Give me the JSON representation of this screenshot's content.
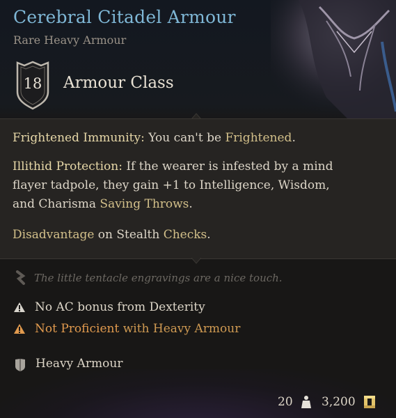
{
  "item": {
    "name": "Cerebral Citadel Armour",
    "rarity_type": "Rare Heavy Armour",
    "armour_class_value": "18",
    "armour_class_label": "Armour Class"
  },
  "properties": {
    "p1_name": "Frightened Immunity:",
    "p1_text_a": " You can't be ",
    "p1_link": "Frightened",
    "p1_text_b": ".",
    "p2_name": "Illithid Protection:",
    "p2_line1": " If the wearer is infested by a mind",
    "p2_line2": "flayer tadpole, they gain +1 to Intelligence, Wisdom,",
    "p2_line3_a": "and Charisma ",
    "p2_line3_link": "Saving Throws",
    "p2_line3_b": ".",
    "p3_link1": "Disadvantage",
    "p3_text_a": " on Stealth ",
    "p3_link2": "Checks",
    "p3_text_b": "."
  },
  "flavor_text": "The little tentacle engravings are a nice touch.",
  "warnings": {
    "w1": "No AC bonus from Dexterity",
    "w2_a": "Not Proficient",
    "w2_b": " with Heavy Armour"
  },
  "category": "Heavy Armour",
  "footer": {
    "weight": "20",
    "price": "3,200"
  },
  "colors": {
    "title": "#7fb7d6",
    "warning_orange": "#e19a4e",
    "link_gold": "#d3c08a"
  },
  "icons": [
    "shield-icon",
    "feather-icon",
    "warning-icon",
    "heavy-armour-icon",
    "weight-icon",
    "gold-coin-icon"
  ]
}
